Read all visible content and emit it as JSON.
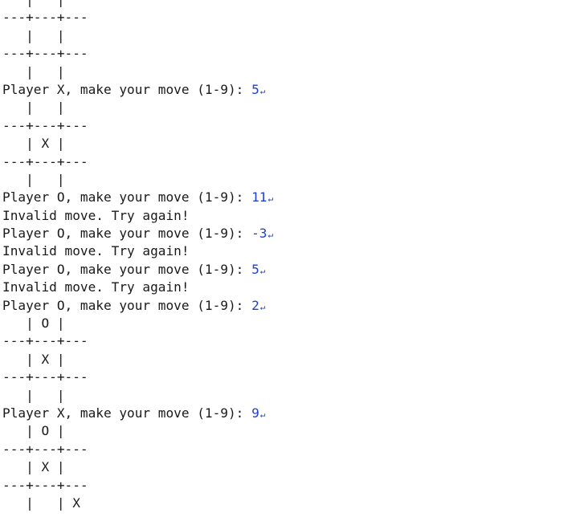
{
  "terminal": {
    "lines": [
      {
        "kind": "board",
        "text": "   |   |"
      },
      {
        "kind": "separator",
        "text": "---+---+---"
      },
      {
        "kind": "board",
        "text": "   |   |"
      },
      {
        "kind": "separator",
        "text": "---+---+---"
      },
      {
        "kind": "board",
        "text": "   |   |"
      },
      {
        "kind": "prompt",
        "text": "Player X, make your move (1-9): ",
        "input": "5",
        "enter_glyph": "↵"
      },
      {
        "kind": "board",
        "text": "   |   |"
      },
      {
        "kind": "separator",
        "text": "---+---+---"
      },
      {
        "kind": "board",
        "text": "   | X |"
      },
      {
        "kind": "separator",
        "text": "---+---+---"
      },
      {
        "kind": "board",
        "text": "   |   |"
      },
      {
        "kind": "prompt",
        "text": "Player O, make your move (1-9): ",
        "input": "11",
        "enter_glyph": "↵"
      },
      {
        "kind": "message",
        "text": "Invalid move. Try again!"
      },
      {
        "kind": "prompt",
        "text": "Player O, make your move (1-9): ",
        "input": "-3",
        "enter_glyph": "↵"
      },
      {
        "kind": "message",
        "text": "Invalid move. Try again!"
      },
      {
        "kind": "prompt",
        "text": "Player O, make your move (1-9): ",
        "input": "5",
        "enter_glyph": "↵"
      },
      {
        "kind": "message",
        "text": "Invalid move. Try again!"
      },
      {
        "kind": "prompt",
        "text": "Player O, make your move (1-9): ",
        "input": "2",
        "enter_glyph": "↵"
      },
      {
        "kind": "board",
        "text": "   | O |"
      },
      {
        "kind": "separator",
        "text": "---+---+---"
      },
      {
        "kind": "board",
        "text": "   | X |"
      },
      {
        "kind": "separator",
        "text": "---+---+---"
      },
      {
        "kind": "board",
        "text": "   |   |"
      },
      {
        "kind": "prompt",
        "text": "Player X, make your move (1-9): ",
        "input": "9",
        "enter_glyph": "↵"
      },
      {
        "kind": "board",
        "text": "   | O |"
      },
      {
        "kind": "separator",
        "text": "---+---+---"
      },
      {
        "kind": "board",
        "text": "   | X |"
      },
      {
        "kind": "separator",
        "text": "---+---+---"
      },
      {
        "kind": "board",
        "text": "   |   | X"
      }
    ]
  },
  "colors": {
    "text": "#1a1a1a",
    "input": "#1f3fd0",
    "background": "#ffffff"
  }
}
